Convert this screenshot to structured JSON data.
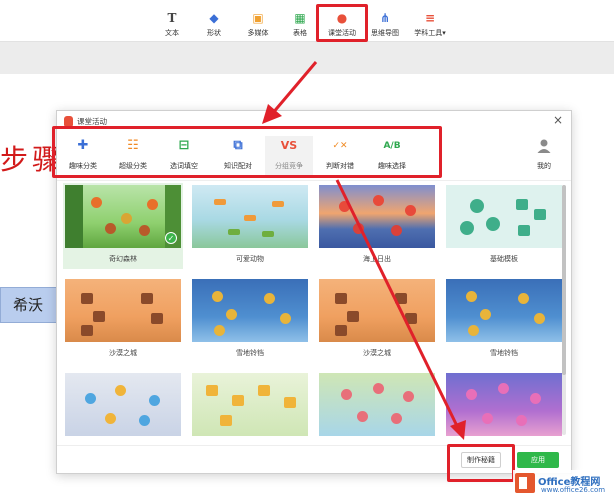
{
  "ribbon": {
    "items": [
      {
        "label": "文本",
        "icon": "text-icon",
        "glyph": "T",
        "color": "#444444"
      },
      {
        "label": "形状",
        "icon": "shapes-icon",
        "glyph": "◆",
        "color": "#3b6fd6"
      },
      {
        "label": "多媒体",
        "icon": "media-icon",
        "glyph": "▣",
        "color": "#f0a030"
      },
      {
        "label": "表格",
        "icon": "table-icon",
        "glyph": "▦",
        "color": "#2fa84f"
      },
      {
        "label": "课堂活动",
        "icon": "class-activity-icon",
        "glyph": "●",
        "color": "#e8503a"
      },
      {
        "label": "思维导图",
        "icon": "mindmap-icon",
        "glyph": "⋔",
        "color": "#3b6fd6"
      },
      {
        "label": "学科工具",
        "icon": "subject-tools-icon",
        "glyph": "≡",
        "color": "#e8503a",
        "dropdown": "▾"
      }
    ]
  },
  "slide": {
    "title_fragment": "步骤",
    "box_text": "希沃"
  },
  "dialog": {
    "title": "课堂活动",
    "close": "×",
    "tabs": [
      {
        "label": "趣味分类",
        "icon": "fun-classify-icon",
        "glyph": "✚",
        "color": "#3b6fd6"
      },
      {
        "label": "超级分类",
        "icon": "super-classify-icon",
        "glyph": "☷",
        "color": "#f08a24"
      },
      {
        "label": "选词填空",
        "icon": "fill-blank-icon",
        "glyph": "⊟",
        "color": "#2fa84f"
      },
      {
        "label": "知识配对",
        "icon": "knowledge-match-icon",
        "glyph": "⧉",
        "color": "#3b6fd6"
      },
      {
        "label": "分组竞争",
        "icon": "group-compete-icon",
        "glyph": "VS",
        "color": "#e8503a"
      },
      {
        "label": "判断对错",
        "icon": "true-false-icon",
        "glyph": "✓✕",
        "color": "#f08a24"
      },
      {
        "label": "趣味选择",
        "icon": "fun-choice-icon",
        "glyph": "A/B",
        "color": "#2fa84f"
      }
    ],
    "mine": {
      "label": "我的",
      "icon": "user-icon"
    },
    "templates": [
      {
        "label": "奇幻森林",
        "selected": true
      },
      {
        "label": "可爱动物",
        "selected": false
      },
      {
        "label": "海上日出",
        "selected": false
      },
      {
        "label": "基础模板",
        "selected": false
      },
      {
        "label": "沙漠之城",
        "selected": false
      },
      {
        "label": "雪地铃铛",
        "selected": false
      },
      {
        "label": "沙漠之城",
        "selected": false
      },
      {
        "label": "雪地铃铛",
        "selected": false
      },
      {
        "label": "",
        "selected": false
      },
      {
        "label": "",
        "selected": false
      },
      {
        "label": "",
        "selected": false
      },
      {
        "label": "",
        "selected": false
      }
    ],
    "buttons": {
      "make": "制作秘籍",
      "apply": "应用"
    }
  },
  "watermark": {
    "brand_a": "Office",
    "brand_b": "教程网",
    "url": "www.office26.com"
  },
  "colors": {
    "highlight": "#e0212a",
    "apply_green": "#2fb84a"
  }
}
